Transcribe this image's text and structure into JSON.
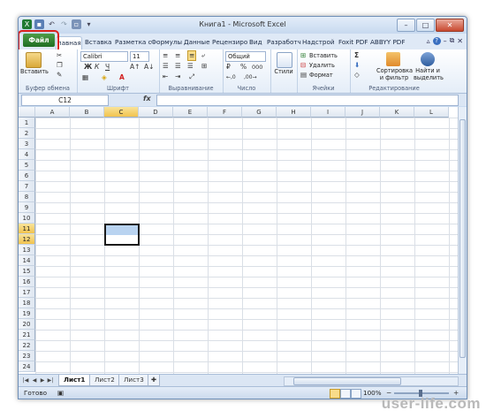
{
  "window": {
    "title": "Книга1 - Microsoft Excel"
  },
  "quick_access": [
    "excel-logo-icon",
    "save-icon",
    "undo-icon",
    "redo-icon",
    "print-preview-icon",
    "customize-qat-icon"
  ],
  "tabs": {
    "file": "Файл",
    "items": [
      {
        "label": "лавная",
        "active": true
      },
      {
        "label": "Вставка"
      },
      {
        "label": "Разметка с"
      },
      {
        "label": "Формулы"
      },
      {
        "label": "Данные"
      },
      {
        "label": "Рецензиро"
      },
      {
        "label": "Вид"
      },
      {
        "label": "Разработч"
      },
      {
        "label": "Надстрой"
      },
      {
        "label": "Foxit PDF"
      },
      {
        "label": "ABBYY PDF"
      }
    ]
  },
  "ribbon": {
    "clipboard": {
      "label": "Буфер обмена",
      "paste": "Вставить"
    },
    "font": {
      "label": "Шрифт",
      "name": "Calibri",
      "size": "11",
      "bold": "Ж",
      "italic": "К",
      "underline": "Ч"
    },
    "alignment": {
      "label": "Выравнивание"
    },
    "number": {
      "label": "Число",
      "format": "Общий",
      "percent": "%",
      "thousands": "000"
    },
    "styles": {
      "label": "Стили"
    },
    "cells": {
      "label": "Ячейки",
      "insert": "Вставить",
      "delete": "Удалить",
      "format": "Формат"
    },
    "editing": {
      "label": "Редактирование",
      "sort": "Сортировка",
      "sort2": "и фильтр",
      "find": "Найти и",
      "find2": "выделить",
      "sum": "Σ"
    }
  },
  "formula_bar": {
    "name_box": "C12",
    "fx": "fx",
    "value": ""
  },
  "sheet": {
    "columns": [
      "A",
      "B",
      "C",
      "D",
      "E",
      "F",
      "G",
      "H",
      "I",
      "J",
      "K",
      "L"
    ],
    "rows": [
      "1",
      "2",
      "3",
      "4",
      "5",
      "6",
      "7",
      "8",
      "9",
      "10",
      "11",
      "12",
      "13",
      "14",
      "15",
      "16",
      "17",
      "18",
      "19",
      "20",
      "21",
      "22",
      "23",
      "24"
    ],
    "active_column": "C",
    "active_rows": [
      "11",
      "12"
    ]
  },
  "sheet_tabs": [
    {
      "label": "Лист1",
      "active": true
    },
    {
      "label": "Лист2"
    },
    {
      "label": "Лист3"
    }
  ],
  "status_bar": {
    "mode": "Готово",
    "zoom": "100%",
    "zoom_out": "−",
    "zoom_in": "+"
  },
  "watermark": "user-life.com",
  "colors": {
    "accent": "#1f6e22",
    "highlight": "#d9201c",
    "selection": "#b9d3f0"
  }
}
